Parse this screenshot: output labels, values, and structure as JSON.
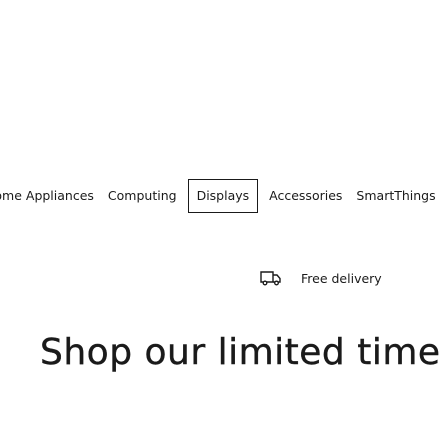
{
  "category_nav": {
    "items": [
      {
        "label": "Home Appliances",
        "selected": false
      },
      {
        "label": "Computing",
        "selected": false
      },
      {
        "label": "Displays",
        "selected": true
      },
      {
        "label": "Accessories",
        "selected": false
      },
      {
        "label": "SmartThings",
        "selected": false
      }
    ]
  },
  "promo": {
    "delivery_icon": "truck-icon",
    "delivery_label": "Free delivery"
  },
  "headline": {
    "text": "Shop our limited time"
  }
}
